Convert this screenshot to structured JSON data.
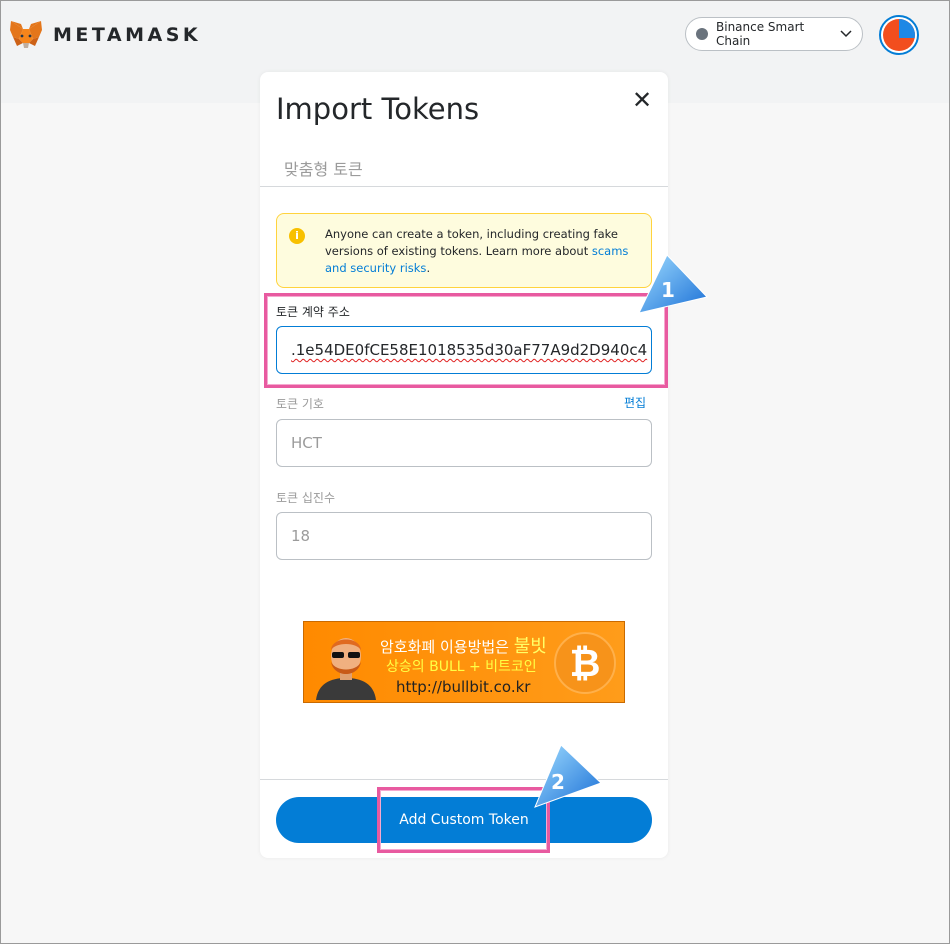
{
  "header": {
    "brand": "METAMASK",
    "network": "Binance Smart Chain"
  },
  "card": {
    "title": "Import Tokens",
    "close_glyph": "✕",
    "tab_label": "맞춤형 토큰",
    "warning": {
      "text": "Anyone can create a token, including creating fake versions of existing tokens. Learn more about ",
      "link": "scams and security risks",
      "suffix": "."
    },
    "contract_label": "토큰 계약 주소",
    "contract_value": ".1e54DE0fCE58E1018535d30aF77A9d2D940c4",
    "symbol_label": "토큰 기호",
    "symbol_edit": "편집",
    "symbol_value": "HCT",
    "decimals_label": "토큰 십진수",
    "decimals_value": "18",
    "add_button": "Add Custom Token"
  },
  "banner": {
    "line1_a": "암호화폐 이용방법은 ",
    "line1_b": "불빗",
    "line2": "상승의 BULL + 비트코인",
    "line3": "http://bullbit.co.kr",
    "coin_glyph": "₿"
  },
  "annotations": {
    "marker1": "1",
    "marker2": "2"
  }
}
